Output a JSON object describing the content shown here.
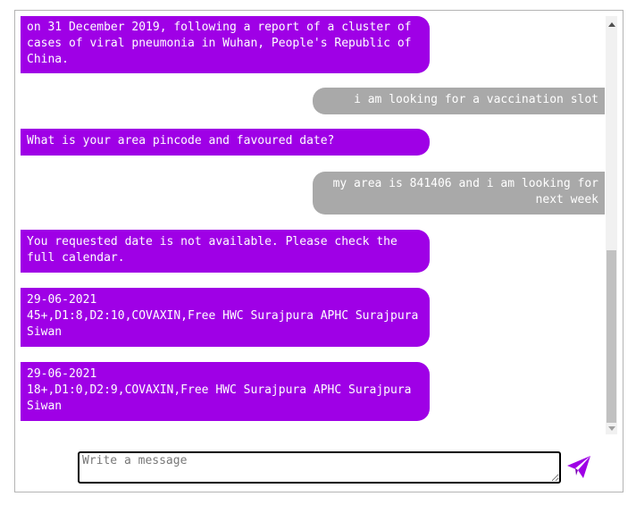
{
  "chat": {
    "messages": [
      {
        "sender": "bot",
        "text": "on 31 December 2019, following a report of a cluster of cases of viral pneumonia in Wuhan, People's Republic of China."
      },
      {
        "sender": "user",
        "text": "i am looking for a vaccination slot"
      },
      {
        "sender": "bot",
        "text": "What is your area pincode and favoured date?"
      },
      {
        "sender": "user",
        "text": "my area is 841406 and i am looking for next week"
      },
      {
        "sender": "bot",
        "text": "You requested date is not available. Please check the full calendar."
      },
      {
        "sender": "bot",
        "text": "29-06-2021\n45+,D1:8,D2:10,COVAXIN,Free HWC Surajpura APHC Surajpura Siwan"
      },
      {
        "sender": "bot",
        "text": "29-06-2021\n18+,D1:0,D2:9,COVAXIN,Free HWC Surajpura APHC Surajpura Siwan"
      }
    ]
  },
  "composer": {
    "placeholder": "Write a message",
    "value": "",
    "send_icon": "send-paper-plane-icon"
  },
  "colors": {
    "bot_bubble": "#9f00e6",
    "user_bubble": "#a9a9a9",
    "send_icon": "#9f00e6"
  }
}
